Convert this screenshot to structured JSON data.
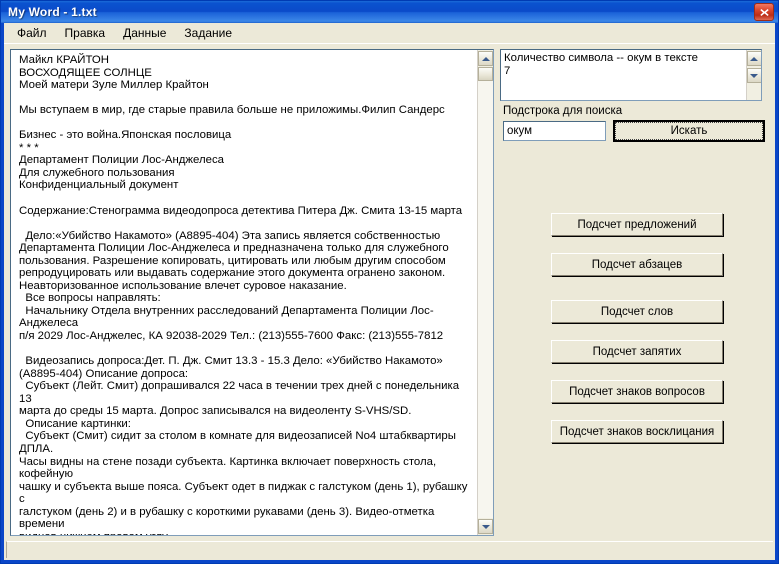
{
  "window": {
    "title": "My Word - 1.txt",
    "close_icon": "close-icon"
  },
  "menubar": {
    "items": [
      {
        "label": "Файл"
      },
      {
        "label": "Правка"
      },
      {
        "label": "Данные"
      },
      {
        "label": "Задание"
      }
    ]
  },
  "document": {
    "content": "Майкл КРАЙТОН\nВОСХОДЯЩЕЕ СОЛНЦЕ\nМоей матери Зуле Миллер Крайтон\n\nМы вступаем в мир, где старые правила больше не приложимы.Филип Сандерс\n\nБизнес - это война.Японская пословица\n* * *\nДепартамент Полиции Лос-Анджелеса\nДля служебного пользования\nКонфиденциальный документ\n\nСодержание:Стенограмма видеодопроса детектива Питера Дж. Смита 13-15 марта\n\n  Дело:«Убийство Накамото» (A8895-404) Эта запись является собственностью\nДепартамента Полиции Лос-Анджелеса и предназначена только для служебного\nпользования. Разрешение копировать, цитировать или любым другим способом\nрепродуцировать или выдавать содержание этого документа огранено законом.\nНеавторизованное использование влечет суровое наказание.\n  Все вопросы направлять:\n  Начальнику Отдела внутренних расследований Департамента Полиции Лос-Анджелеса\nп/я 2029 Лос-Анджелес, КА 92038-2029 Тел.: (213)555-7600 Факс: (213)555-7812\n\n  Видеозапись допроса:Дет. П. Дж. Смит 13.3 - 15.3 Дело: «Убийство Накамото»\n(A8895-404) Описание допроса:\n  Субъект (Лейт. Смит) допрашивался 22 часа в течении трех дней с понедельника 13\nмарта до среды 15 марта. Допрос записывался на видеоленту S-VHS/SD.\n  Описание картинки:\n  Субъект (Смит) сидит за столом в комнате для видеозаписей No4 штабквартиры ДПЛА.\nЧасы видны на стене позади субъекта. Картинка включает поверхность стола, кофейную\nчашку и субъекта выше пояса. Субъект одет в пиджак с галстуком (день 1), рубашку с\nгалстуком (день 2) и в рубашку с короткими рукавами (день 3). Видео-отметка времени\nвиднав нижнем правом углу.\n  Цель допроса:\n  Выяснение роли субъекта в деле «Убийство Накамото» (A8895-404). Ведущие допрос\nофицеры: дет. Т. Конвей и дет. Р. Хеммонд. Субъект отказался от права присутствия"
  },
  "panel": {
    "result_text": "Количество символа -- окум в тексте\n7",
    "search_label": "Подстрока для поиска",
    "search_value": "окум",
    "search_placeholder": "",
    "search_button": "Искать",
    "actions": [
      {
        "label": "Подсчет предложений"
      },
      {
        "label": "Подсчет абзацев"
      },
      {
        "label": "Подсчет слов"
      },
      {
        "label": "Подсчет запятих"
      },
      {
        "label": "Подсчет знаков вопросов"
      },
      {
        "label": "Подсчет знаков восклицания"
      }
    ]
  },
  "colors": {
    "titlebar": "#0a52cf",
    "client_bg": "#ece9d8",
    "close_button": "#d9442a",
    "field_border": "#7f9db9"
  }
}
